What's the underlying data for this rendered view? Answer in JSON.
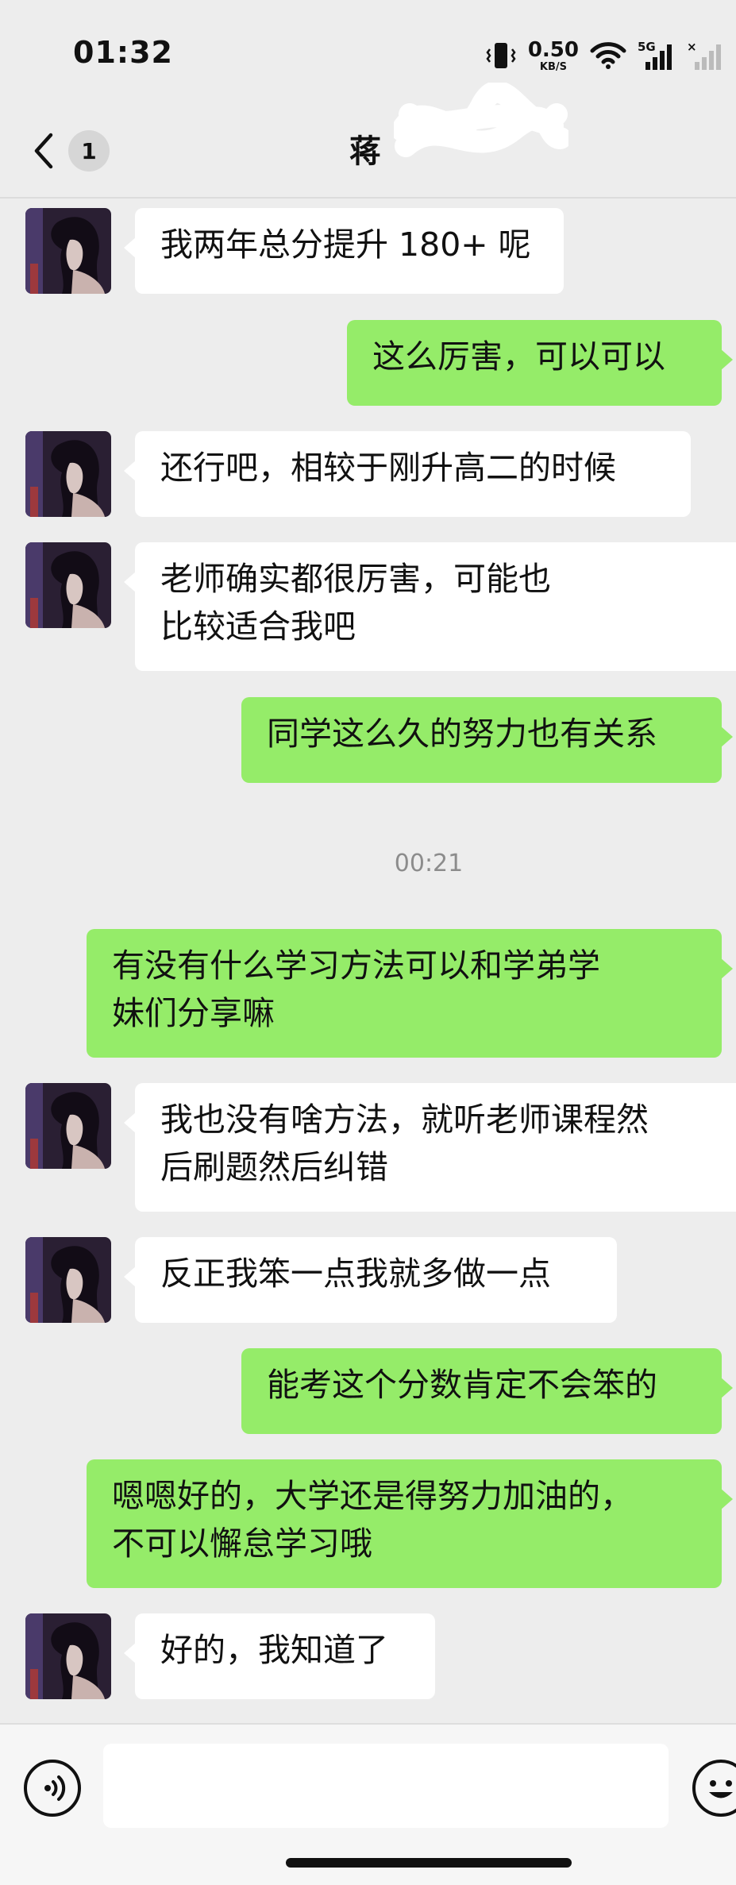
{
  "status_bar": {
    "time": "01:32",
    "net_speed_value": "0.50",
    "net_speed_unit": "KB/S",
    "network_type": "5G",
    "no_signal_mark": "×",
    "icons": [
      "vibrate-icon",
      "wifi-icon",
      "signal-5g-icon",
      "signal-no-sim-icon"
    ]
  },
  "header": {
    "unread_badge": "1",
    "title": "蒋"
  },
  "messages": [
    {
      "side": "in",
      "text": "我两年总分提升 180+ 呢"
    },
    {
      "side": "out",
      "text": "这么厉害，可以可以"
    },
    {
      "side": "in",
      "text": "还行吧，相较于刚升高二的时候"
    },
    {
      "side": "in",
      "text": "老师确实都很厉害，可能也\n比较适合我吧"
    },
    {
      "side": "out",
      "text": "同学这么久的努力也有关系"
    },
    {
      "side": "time",
      "text": "00:21"
    },
    {
      "side": "out",
      "text": "有没有什么学习方法可以和学弟学\n妹们分享嘛"
    },
    {
      "side": "in",
      "text": "我也没有啥方法，就听老师课程然\n后刷题然后纠错"
    },
    {
      "side": "in",
      "text": "反正我笨一点我就多做一点"
    },
    {
      "side": "out",
      "text": "能考这个分数肯定不会笨的"
    },
    {
      "side": "out",
      "text": "嗯嗯好的，大学还是得努力加油的，\n不可以懈怠学习哦"
    },
    {
      "side": "in",
      "text": "好的，我知道了"
    }
  ],
  "input": {
    "value": "",
    "placeholder": ""
  },
  "colors": {
    "background": "#ededed",
    "incoming_bubble": "#ffffff",
    "outgoing_bubble": "#95ec69",
    "timestamp_text": "#8c8c8c"
  }
}
